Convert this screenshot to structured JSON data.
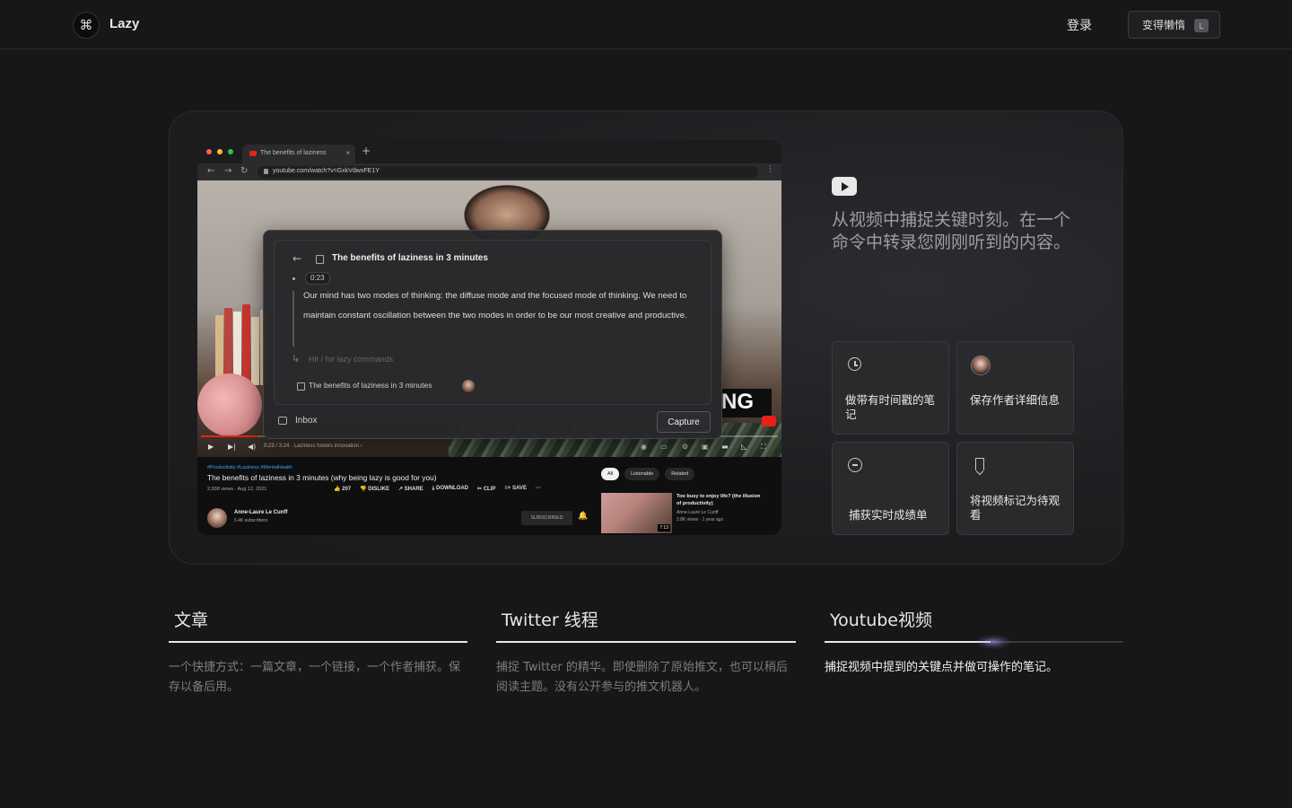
{
  "header": {
    "logo_glyph": "⌘",
    "brand": "Lazy",
    "login": "登录",
    "cta_label": "变得懒惰",
    "cta_shortcut": "L"
  },
  "browser": {
    "tab_title": "The benefits of laziness",
    "tab_close": "×",
    "tab_new": "+",
    "url": "youtube.com/watch?v=GxkVdwxFE1Y",
    "nav": {
      "back": "←",
      "forward": "→",
      "reload": "↻",
      "menu": "⋮"
    }
  },
  "video": {
    "overlay_word": "NG",
    "progress": 0.1,
    "timecode": "0:23 / 3:24 · Laziness fosters innovation ›"
  },
  "lazy_overlay": {
    "back": "←",
    "doc_title": "The benefits of laziness in 3 minutes",
    "timestamp": "0:23",
    "transcript": "Our mind has two modes of thinking: the diffuse mode and the focused mode of thinking. We need to maintain constant oscillation between the two modes in order to be our most creative and productive.",
    "command_arrow": "↳",
    "command_placeholder": "Hit   /   for lazy commands",
    "source": "The benefits of laziness in 3 minutes",
    "inbox": "Inbox",
    "capture": "Capture"
  },
  "youtube": {
    "tags": "#Productivity #Laziness #MentalHealth",
    "title": "The benefits of laziness in 3 minutes (why being lazy is good for you)",
    "meta": "2,938 views · Aug 12, 2021",
    "actions": [
      "👍 207",
      "👎 DISLIKE",
      "↗ SHARE",
      "⤓ DOWNLOAD",
      "✂ CLIP",
      "≡+ SAVE",
      "···"
    ],
    "channel_name": "Anne-Laure Le Cunff",
    "channel_subs": "5.4K subscribers",
    "subscribed": "SUBSCRIBED",
    "bell": "🔔",
    "chips": [
      "All",
      "Listenable",
      "Related"
    ],
    "rec_title": "Too busy to enjoy life? (the illusion of productivity)",
    "rec_author": "Anne-Laure Le Cunff",
    "rec_views": "3.8K views · 1 year ago",
    "rec_duration": "7:13"
  },
  "feature_panel": {
    "icon": "youtube-icon",
    "headline": "从视频中捕捉关键时刻。在一个命令中转录您刚刚听到的内容。",
    "features": [
      {
        "icon": "clock-icon",
        "label": "做带有时间戳的笔记"
      },
      {
        "icon": "avatar-icon",
        "label": "保存作者详细信息"
      },
      {
        "icon": "chat-icon",
        "label": "捕获实时成绩单"
      },
      {
        "icon": "bookmark-icon",
        "label": "将视频标记为待观看"
      }
    ]
  },
  "bottom_tabs": [
    {
      "title": "文章",
      "desc": "一个快捷方式：一篇文章，一个链接，一个作者捕获。保存以备后用。"
    },
    {
      "title": "Twitter 线程",
      "desc": "捕捉 Twitter 的精华。即使删除了原始推文，也可以稍后阅读主题。没有公开参与的推文机器人。"
    },
    {
      "title": "Youtube视频",
      "desc": "捕捉视频中提到的关键点并做可操作的笔记。"
    }
  ],
  "colors": {
    "background": "#171718",
    "youtube_red": "#e62117",
    "link_blue": "#3ea6ff"
  }
}
